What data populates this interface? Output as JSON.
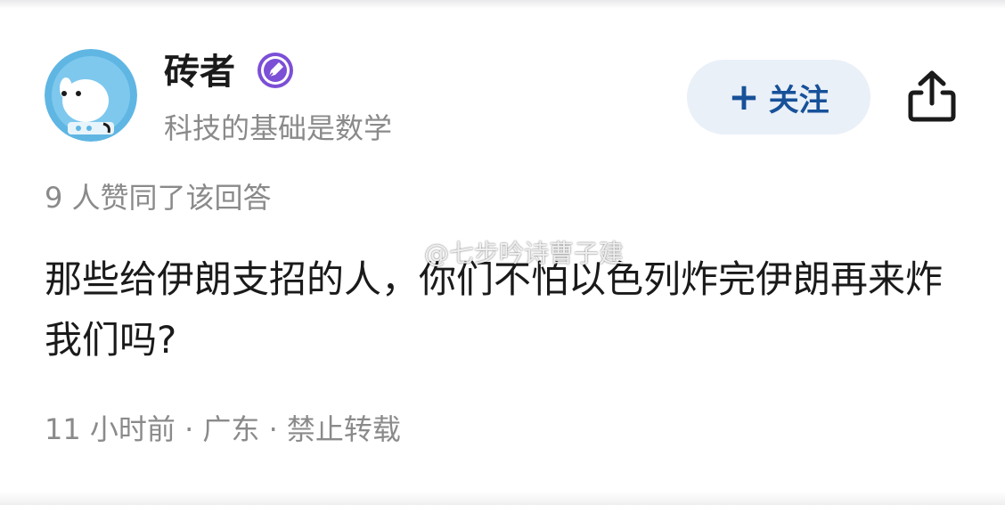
{
  "author": {
    "name": "砖者",
    "bio": "科技的基础是数学",
    "avatar_icon": "astronaut-dog-avatar",
    "badge_icon": "pen-badge-icon"
  },
  "actions": {
    "follow_label": "关注",
    "follow_icon": "plus-icon",
    "share_icon": "share-icon"
  },
  "answer": {
    "likes_text": "9 人赞同了该回答",
    "content": "那些给伊朗支招的人，你们不怕以色列炸完伊朗再来炸我们吗?",
    "meta_text": "11 小时前 · 广东 · 禁止转载"
  },
  "watermark": {
    "text": "@七步吟诗曹子建",
    "icon": "weibo-icon"
  },
  "colors": {
    "accent": "#175199",
    "follow_bg": "#eaf0f8",
    "badge": "#7b4fd6",
    "muted_text": "#8a8a8a"
  }
}
